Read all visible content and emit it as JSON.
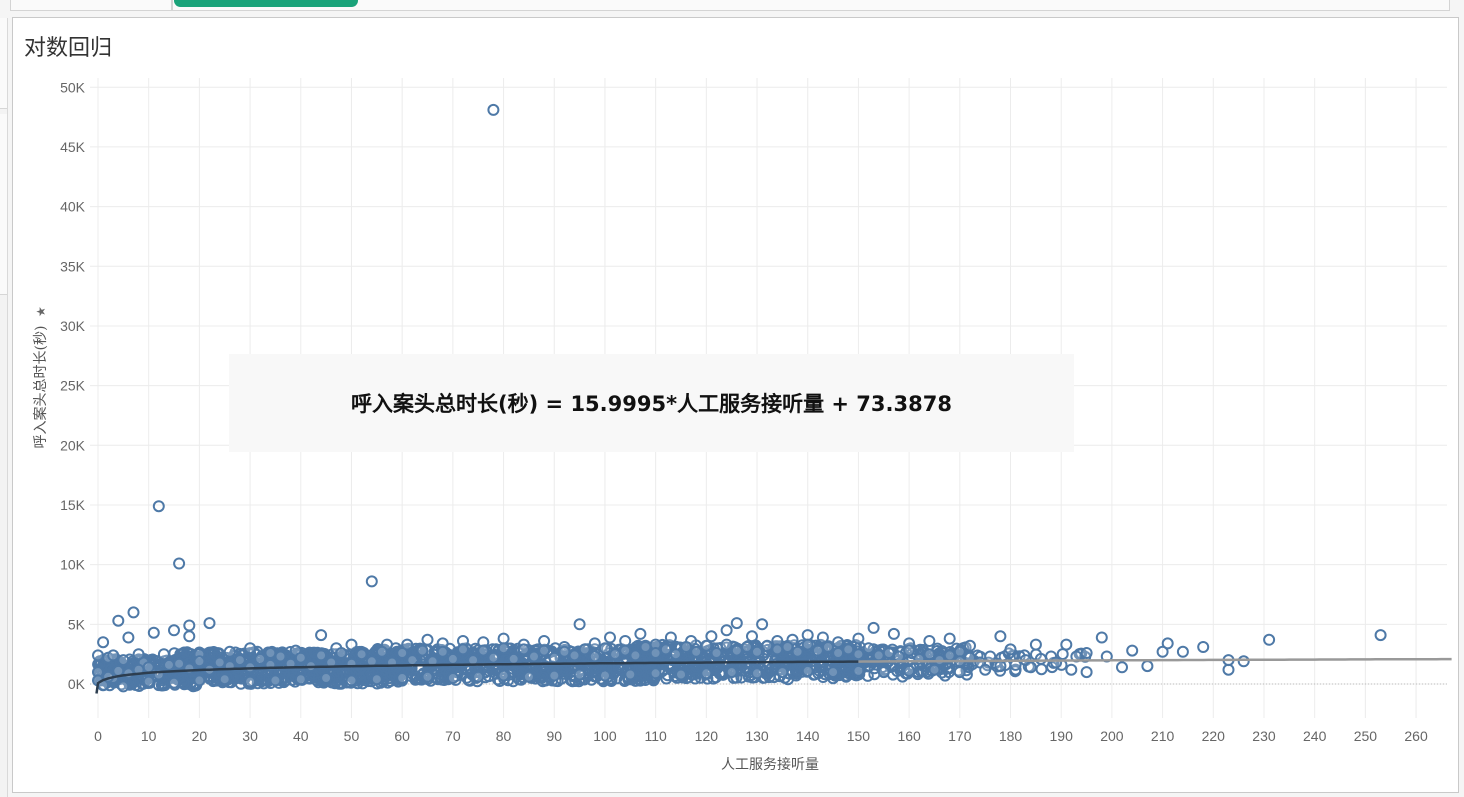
{
  "title": "对数回归",
  "equation": "呼入案头总时长(秒) = 15.9995*人工服务接听量 + 73.3878",
  "colors": {
    "point_stroke": "#4e79a7",
    "trend_dark": "#2d3e50",
    "trend_light": "#999999",
    "grid": "#ececec",
    "title_bar": "#1aa37a"
  },
  "chart_data": {
    "type": "scatter",
    "xlabel": "人工服务接听量",
    "ylabel": "呼入案头总时长(秒)",
    "xlim": [
      -2,
      267
    ],
    "ylim": [
      -3000,
      51000
    ],
    "x_ticks": [
      0,
      10,
      20,
      30,
      40,
      50,
      60,
      70,
      80,
      90,
      100,
      110,
      120,
      130,
      140,
      150,
      160,
      170,
      180,
      190,
      200,
      210,
      220,
      230,
      240,
      250,
      260
    ],
    "y_ticks": [
      0,
      5000,
      10000,
      15000,
      20000,
      25000,
      30000,
      35000,
      40000,
      45000,
      50000
    ],
    "y_tick_labels": [
      "0K",
      "5K",
      "10K",
      "15K",
      "20K",
      "25K",
      "30K",
      "35K",
      "40K",
      "45K",
      "50K"
    ],
    "grid": true,
    "marker": "open-circle",
    "trend": {
      "type": "logarithmic",
      "extends_to_x": 267
    },
    "points": [
      [
        78,
        48100
      ],
      [
        12,
        14900
      ],
      [
        16,
        10100
      ],
      [
        54,
        8600
      ],
      [
        7,
        6000
      ],
      [
        4,
        5300
      ],
      [
        22,
        5100
      ],
      [
        95,
        5000
      ],
      [
        131,
        5000
      ],
      [
        126,
        5100
      ],
      [
        11,
        4300
      ],
      [
        15,
        4500
      ],
      [
        18,
        4900
      ],
      [
        18,
        4000
      ],
      [
        6,
        3900
      ],
      [
        1,
        3500
      ],
      [
        44,
        4100
      ],
      [
        107,
        4200
      ],
      [
        101,
        3900
      ],
      [
        153,
        4700
      ],
      [
        178,
        4000
      ],
      [
        198,
        3900
      ],
      [
        253,
        4100
      ],
      [
        231,
        3700
      ],
      [
        211,
        3400
      ],
      [
        218,
        3100
      ],
      [
        204,
        2800
      ],
      [
        210,
        2700
      ],
      [
        191,
        3300
      ],
      [
        195,
        2600
      ],
      [
        185,
        3300
      ],
      [
        180,
        2900
      ],
      [
        188,
        2300
      ],
      [
        183,
        2000
      ],
      [
        176,
        2300
      ],
      [
        172,
        3200
      ],
      [
        170,
        2700
      ],
      [
        168,
        3800
      ],
      [
        164,
        3600
      ],
      [
        160,
        3400
      ],
      [
        157,
        4200
      ],
      [
        150,
        3800
      ],
      [
        146,
        3500
      ],
      [
        143,
        3900
      ],
      [
        140,
        4100
      ],
      [
        137,
        3700
      ],
      [
        134,
        3600
      ],
      [
        129,
        4000
      ],
      [
        124,
        4500
      ],
      [
        121,
        4000
      ],
      [
        117,
        3600
      ],
      [
        113,
        3900
      ],
      [
        110,
        3300
      ],
      [
        104,
        3600
      ],
      [
        98,
        3400
      ],
      [
        92,
        3100
      ],
      [
        88,
        3600
      ],
      [
        84,
        3300
      ],
      [
        80,
        3800
      ],
      [
        76,
        3500
      ],
      [
        72,
        3600
      ],
      [
        68,
        3400
      ],
      [
        65,
        3700
      ],
      [
        61,
        3300
      ],
      [
        57,
        3300
      ],
      [
        50,
        3300
      ],
      [
        47,
        3000
      ],
      [
        39,
        2800
      ],
      [
        34,
        2600
      ],
      [
        30,
        3000
      ],
      [
        26,
        2700
      ],
      [
        2,
        2200
      ],
      [
        5,
        2000
      ],
      [
        9,
        1800
      ],
      [
        3,
        2400
      ],
      [
        8,
        2500
      ],
      [
        13,
        2500
      ],
      [
        20,
        2500
      ],
      [
        0,
        1000
      ],
      [
        0,
        300
      ],
      [
        0,
        2400
      ],
      [
        1,
        -100
      ],
      [
        3,
        500
      ],
      [
        2,
        600
      ],
      [
        4,
        1100
      ],
      [
        6,
        900
      ],
      [
        8,
        1200
      ],
      [
        10,
        1400
      ],
      [
        12,
        800
      ],
      [
        14,
        1600
      ],
      [
        16,
        1700
      ],
      [
        18,
        1300
      ],
      [
        20,
        1900
      ],
      [
        22,
        1200
      ],
      [
        24,
        1800
      ],
      [
        26,
        1500
      ],
      [
        28,
        2000
      ],
      [
        30,
        1400
      ],
      [
        32,
        2100
      ],
      [
        34,
        1600
      ],
      [
        36,
        2300
      ],
      [
        38,
        1700
      ],
      [
        40,
        2200
      ],
      [
        42,
        1500
      ],
      [
        44,
        2400
      ],
      [
        46,
        1800
      ],
      [
        48,
        2600
      ],
      [
        50,
        1700
      ],
      [
        52,
        2500
      ],
      [
        54,
        1900
      ],
      [
        56,
        2700
      ],
      [
        58,
        1800
      ],
      [
        60,
        2600
      ],
      [
        62,
        2000
      ],
      [
        64,
        2800
      ],
      [
        66,
        1900
      ],
      [
        68,
        2700
      ],
      [
        70,
        2100
      ],
      [
        72,
        2900
      ],
      [
        74,
        2000
      ],
      [
        76,
        2800
      ],
      [
        78,
        2200
      ],
      [
        80,
        3000
      ],
      [
        82,
        2100
      ],
      [
        84,
        2900
      ],
      [
        86,
        2300
      ],
      [
        88,
        2800
      ],
      [
        90,
        2200
      ],
      [
        92,
        2700
      ],
      [
        94,
        2400
      ],
      [
        96,
        2900
      ],
      [
        98,
        2300
      ],
      [
        100,
        3000
      ],
      [
        102,
        2500
      ],
      [
        104,
        2800
      ],
      [
        106,
        2400
      ],
      [
        108,
        3100
      ],
      [
        110,
        2600
      ],
      [
        112,
        2900
      ],
      [
        114,
        2500
      ],
      [
        116,
        3100
      ],
      [
        118,
        2700
      ],
      [
        120,
        3200
      ],
      [
        122,
        2600
      ],
      [
        124,
        3300
      ],
      [
        126,
        2800
      ],
      [
        128,
        3100
      ],
      [
        130,
        2700
      ],
      [
        132,
        3200
      ],
      [
        134,
        2900
      ],
      [
        136,
        3100
      ],
      [
        138,
        2700
      ],
      [
        140,
        3300
      ],
      [
        142,
        2800
      ],
      [
        144,
        3100
      ],
      [
        146,
        2600
      ],
      [
        148,
        2900
      ],
      [
        150,
        2500
      ],
      [
        152,
        3000
      ],
      [
        154,
        2400
      ],
      [
        156,
        2600
      ],
      [
        158,
        2300
      ],
      [
        160,
        2800
      ],
      [
        162,
        2100
      ],
      [
        164,
        2500
      ],
      [
        166,
        2000
      ],
      [
        168,
        2400
      ],
      [
        170,
        1900
      ],
      [
        172,
        2200
      ],
      [
        174,
        1800
      ],
      [
        5,
        -200
      ],
      [
        10,
        200
      ],
      [
        15,
        100
      ],
      [
        20,
        300
      ],
      [
        25,
        400
      ],
      [
        30,
        200
      ],
      [
        35,
        300
      ],
      [
        40,
        400
      ],
      [
        45,
        500
      ],
      [
        50,
        300
      ],
      [
        55,
        400
      ],
      [
        60,
        500
      ],
      [
        65,
        600
      ],
      [
        70,
        500
      ],
      [
        75,
        600
      ],
      [
        80,
        700
      ],
      [
        85,
        600
      ],
      [
        90,
        700
      ],
      [
        95,
        800
      ],
      [
        100,
        700
      ],
      [
        105,
        800
      ],
      [
        110,
        900
      ],
      [
        115,
        800
      ],
      [
        120,
        900
      ],
      [
        125,
        1000
      ],
      [
        130,
        900
      ],
      [
        135,
        1000
      ],
      [
        140,
        1100
      ],
      [
        145,
        1000
      ],
      [
        150,
        1100
      ],
      [
        155,
        1000
      ],
      [
        160,
        1100
      ],
      [
        165,
        1200
      ],
      [
        170,
        1000
      ],
      [
        175,
        1200
      ],
      [
        178,
        1500
      ],
      [
        181,
        1600
      ],
      [
        184,
        1400
      ],
      [
        189,
        1800
      ],
      [
        192,
        1200
      ],
      [
        195,
        1000
      ],
      [
        202,
        1400
      ],
      [
        207,
        1500
      ],
      [
        214,
        2700
      ],
      [
        223,
        1200
      ],
      [
        223,
        2000
      ],
      [
        226,
        1900
      ],
      [
        186,
        2100
      ],
      [
        193,
        2300
      ],
      [
        199,
        2300
      ]
    ],
    "cloud": [
      {
        "x": [
          0,
          20
        ],
        "ymin": -200,
        "ymax": 2100,
        "n": 260
      },
      {
        "x": [
          15,
          60
        ],
        "ymin": 0,
        "ymax": 2700,
        "n": 650
      },
      {
        "x": [
          55,
          110
        ],
        "ymin": 200,
        "ymax": 3000,
        "n": 650
      },
      {
        "x": [
          105,
          150
        ],
        "ymin": 400,
        "ymax": 3300,
        "n": 480
      },
      {
        "x": [
          145,
          172
        ],
        "ymin": 600,
        "ymax": 3100,
        "n": 170
      },
      {
        "x": [
          165,
          195
        ],
        "ymin": 900,
        "ymax": 2600,
        "n": 40
      }
    ]
  }
}
